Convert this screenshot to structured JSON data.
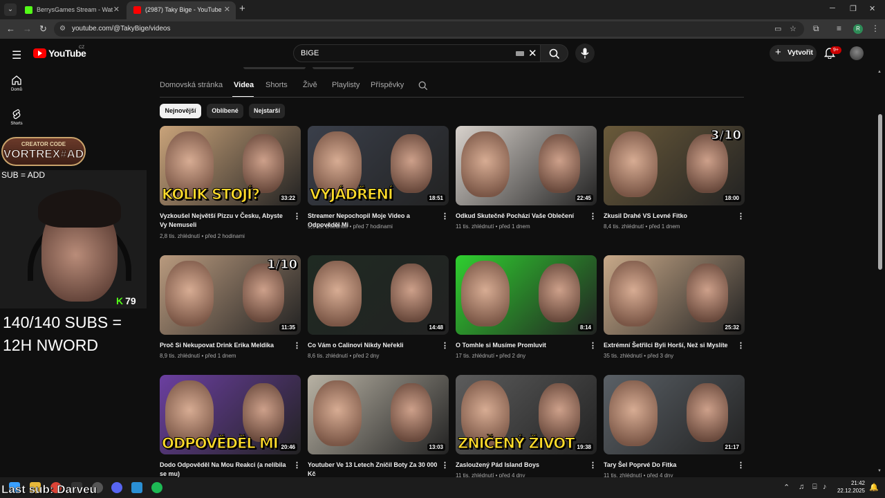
{
  "browser": {
    "tabs": [
      {
        "title": "BerrysGames Stream - Watch Li",
        "favicon_color": "#53fc18",
        "active": false
      },
      {
        "title": "(2987) Taky Bige - YouTube",
        "favicon_color": "#ff0000",
        "active": true
      }
    ],
    "new_tab": "+",
    "url": "youtube.com/@TakyBige/videos"
  },
  "yt": {
    "logo": "YouTube",
    "country": "CZ",
    "search_query": "BIGE",
    "create_label": "Vytvořit",
    "notifications_badge": "9+"
  },
  "sidebar": [
    {
      "label": "Domů",
      "icon": "home-icon"
    },
    {
      "label": "Shorts",
      "icon": "shorts-icon"
    }
  ],
  "channel_tabs": [
    "Domovská stránka",
    "Videa",
    "Shorts",
    "Živě",
    "Playlisty",
    "Příspěvky"
  ],
  "active_tab": "Videa",
  "chips": [
    "Nejnovější",
    "Oblíbené",
    "Nejstarší"
  ],
  "selected_chip": "Nejnovější",
  "videos": [
    {
      "title": "Vyzkoušel Největší Pizzu v Česku, Abyste Vy Nemuseli",
      "views": "2,8 tis. zhlédnutí",
      "age": "před 2 hodinami",
      "duration": "33:22",
      "caption": "KOLIK STOJÍ?",
      "corner": "",
      "bg": "#c9a37a"
    },
    {
      "title": "Streamer Nepochopil Moje Video a Odpověděl Mi",
      "views": "5,5 tis. zhlédnutí",
      "age": "před 7 hodinami",
      "duration": "18:51",
      "caption": "VYJÁDŘENÍ",
      "corner": "",
      "bg": "#3a3f4a"
    },
    {
      "title": "Odkud Skutečně Pochází Vaše Oblečení",
      "views": "11 tis. zhlédnutí",
      "age": "před 1 dnem",
      "duration": "22:45",
      "caption": "",
      "corner": "",
      "bg": "#d8d2cc"
    },
    {
      "title": "Zkusil Drahé VS Levné Fitko",
      "views": "8,4 tis. zhlédnutí",
      "age": "před 1 dnem",
      "duration": "18:00",
      "caption": "",
      "corner": "3/10",
      "bg": "#6a5a3a"
    },
    {
      "title": "Proč Si Nekupovat Drink Erika Meldika",
      "views": "8,9 tis. zhlédnutí",
      "age": "před 1 dnem",
      "duration": "11:35",
      "caption": "",
      "corner": "1/10",
      "bg": "#b99a7e"
    },
    {
      "title": "Co Vám o Calinovi Nikdy Neřekli",
      "views": "8,6 tis. zhlédnutí",
      "age": "před 2 dny",
      "duration": "14:48",
      "caption": "",
      "corner": "",
      "bg": "#1f2a22"
    },
    {
      "title": "O Tomhle si Musíme Promluvit",
      "views": "17 tis. zhlédnutí",
      "age": "před 2 dny",
      "duration": "8:14",
      "caption": "",
      "corner": "",
      "bg": "#2fcf2f"
    },
    {
      "title": "Extrémní Šetřilci Byli Horší, Než si Myslíte",
      "views": "35 tis. zhlédnutí",
      "age": "před 3 dny",
      "duration": "25:32",
      "caption": "",
      "corner": "",
      "bg": "#c8a989"
    },
    {
      "title": "Dodo Odpověděl Na Mou Reakci (a nelíbila se mu)",
      "views": "",
      "age": "",
      "duration": "20:46",
      "caption": "ODPOVĚDĚL MI",
      "corner": "",
      "bg": "#6b3fa0"
    },
    {
      "title": "Youtuber Ve 13 Letech Zničil Boty Za 30 000 Kč",
      "views": "",
      "age": "",
      "duration": "13:03",
      "caption": "",
      "corner": "",
      "bg": "#b8b2a4"
    },
    {
      "title": "Zasloužený Pád Island Boys",
      "views": "11 tis. zhlédnutí",
      "age": "před 4 dny",
      "duration": "19:38",
      "caption": "ZNIČENÝ ŽIVOT",
      "corner": "",
      "bg": "#5c5c5c"
    },
    {
      "title": "Tary Šel Poprvé Do Fitka",
      "views": "11 tis. zhlédnutí",
      "age": "před 4 dny",
      "duration": "21:17",
      "caption": "",
      "corner": "",
      "bg": "#5a6066"
    }
  ],
  "overlay": {
    "creator_line1": "CREATOR CODE",
    "creator_line2": "VORTREX#AD",
    "sub_add": "SUB = ADD",
    "kick_viewers": "79",
    "goal_line1": "140/140 SUBS =",
    "goal_line2": "12H NWORD",
    "last_sub": "Last sub: Darveu"
  },
  "taskbar": {
    "time": "21:42",
    "date": "22.12.2025"
  },
  "colors": {
    "yt_red": "#ff0000",
    "kick_green": "#53fc18",
    "bg": "#0f0f0f"
  }
}
